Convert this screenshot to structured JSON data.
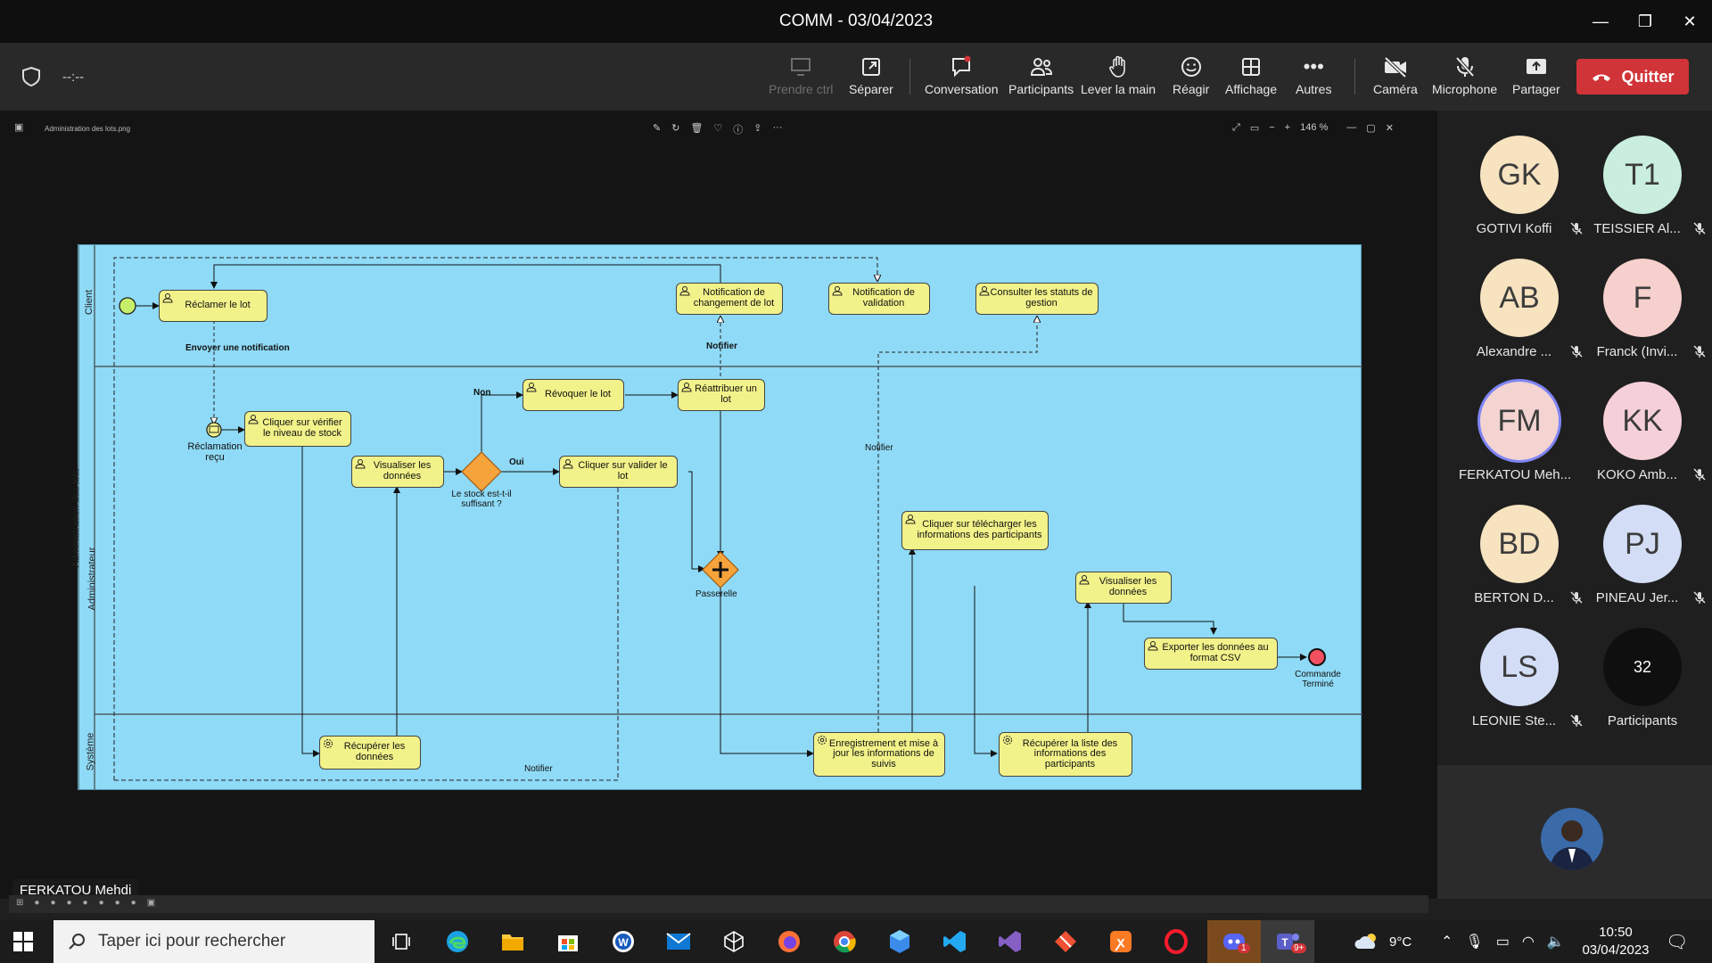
{
  "window": {
    "title": "COMM - 03/04/2023"
  },
  "meeting": {
    "timer": "--:--",
    "toolbar": {
      "take_control": "Prendre ctrl",
      "separate": "Séparer",
      "chat": "Conversation",
      "participants": "Participants",
      "raise_hand": "Lever la main",
      "react": "Réagir",
      "view": "Affichage",
      "more": "Autres",
      "camera": "Caméra",
      "microphone": "Microphone",
      "share": "Partager",
      "leave": "Quitter"
    },
    "speaker": "FERKATOU Mehdi"
  },
  "viewer": {
    "filename": "Administration des lots.png",
    "zoom": "146 %"
  },
  "diagram": {
    "lanes": {
      "client": "Client",
      "pool": "Administration des lots",
      "admin": "Administrateur",
      "system": "Système"
    },
    "tasks": {
      "t1": "Réclamer le lot",
      "t2": "Cliquer sur vérifier le niveau de stock",
      "t3": "Visualiser les données",
      "t4": "Révoquer le lot",
      "t5": "Réattribuer un lot",
      "t6": "Cliquer sur valider le lot",
      "t7": "Notification de changement de lot",
      "t8": "Notification de validation",
      "t9": "Consulter les statuts de gestion",
      "t10": "Cliquer sur télécharger les informations des participants",
      "t11": "Visualiser les données",
      "t12": "Exporter les données au format CSV",
      "t13": "Récupérer les données",
      "t14": "Enregistrement et mise à jour les informations de suivis",
      "t15": "Récupérer la liste des informations des participants"
    },
    "labels": {
      "send_notif": "Envoyer une notification",
      "claim_received": "Réclamation reçu",
      "question": "Le stock est-t-il suffisant ?",
      "no": "Non",
      "yes": "Oui",
      "notify1": "Notifier",
      "notify2": "Notifier",
      "notify3": "Notifier",
      "gateway": "Passerelle",
      "end": "Commande Terminé"
    }
  },
  "participants": [
    {
      "initials": "GK",
      "name": "GOTIVI Koffi",
      "color": "#f7e3c0",
      "muted": true
    },
    {
      "initials": "T1",
      "name": "TEISSIER Al...",
      "color": "#c9eedd",
      "muted": true
    },
    {
      "initials": "AB",
      "name": "Alexandre ...",
      "color": "#f7e3c0",
      "muted": true
    },
    {
      "initials": "F",
      "name": "Franck (Invi...",
      "color": "#f6d0cc",
      "muted": true
    },
    {
      "initials": "FM",
      "name": "FERKATOU Meh...",
      "color": "#f3d4d0",
      "muted": false
    },
    {
      "initials": "KK",
      "name": "KOKO Amb...",
      "color": "#f6d0d8",
      "muted": true
    },
    {
      "initials": "BD",
      "name": "BERTON D...",
      "color": "#f7e3c0",
      "muted": true
    },
    {
      "initials": "PJ",
      "name": "PINEAU Jer...",
      "color": "#d3ddf6",
      "muted": true
    },
    {
      "initials": "LS",
      "name": "LEONIE Ste...",
      "color": "#d3ddf6",
      "muted": true
    }
  ],
  "participants_more": {
    "count": "32",
    "label": "Participants"
  },
  "taskbar": {
    "search_placeholder": "Taper ici pour rechercher",
    "weather": "9°C",
    "time": "10:50",
    "date": "03/04/2023",
    "badge_teams": "9+",
    "badge_discord": "1"
  }
}
